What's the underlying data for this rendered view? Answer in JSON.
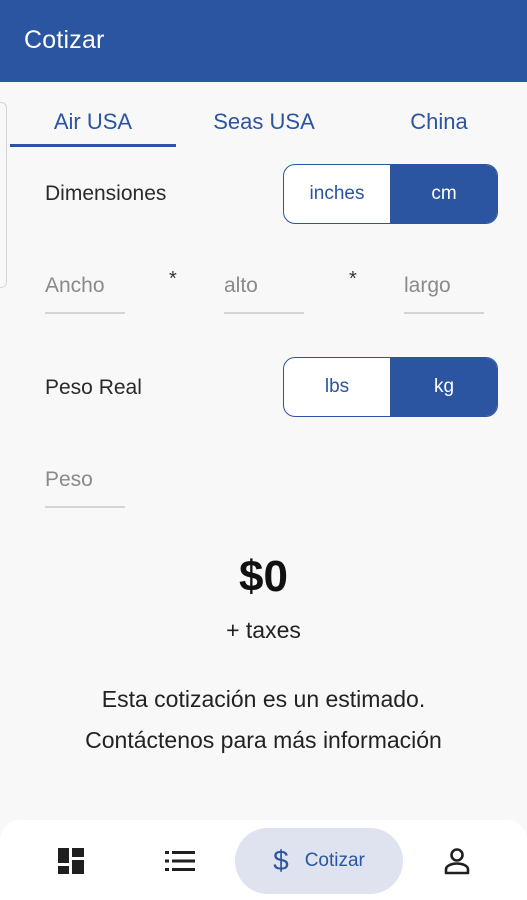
{
  "appbar": {
    "title": "Cotizar"
  },
  "tabs": [
    {
      "label": "Air USA",
      "active": true
    },
    {
      "label": "Seas USA",
      "active": false
    },
    {
      "label": "China",
      "active": false
    }
  ],
  "dimensions": {
    "label": "Dimensiones",
    "units": [
      "inches",
      "cm"
    ],
    "selected_unit": "cm",
    "fields": [
      {
        "placeholder": "Ancho",
        "value": ""
      },
      {
        "placeholder": "alto",
        "value": ""
      },
      {
        "placeholder": "largo",
        "value": ""
      }
    ],
    "separator": "*"
  },
  "weight": {
    "label": "Peso Real",
    "units": [
      "lbs",
      "kg"
    ],
    "selected_unit": "kg",
    "field": {
      "placeholder": "Peso",
      "value": ""
    }
  },
  "quote": {
    "price": "$0",
    "taxes": "+ taxes",
    "note_line1": "Esta cotización es un estimado.",
    "note_line2": "Contáctenos para más información"
  },
  "bottom_nav": {
    "items": [
      {
        "icon": "dashboard-icon"
      },
      {
        "icon": "list-icon"
      },
      {
        "icon": "dollar-icon",
        "label": "Cotizar",
        "active": true
      },
      {
        "icon": "person-icon"
      }
    ]
  },
  "colors": {
    "primary": "#2b55a0",
    "background": "#f8f8f9",
    "nav_active_bg": "#dfe3ef"
  }
}
